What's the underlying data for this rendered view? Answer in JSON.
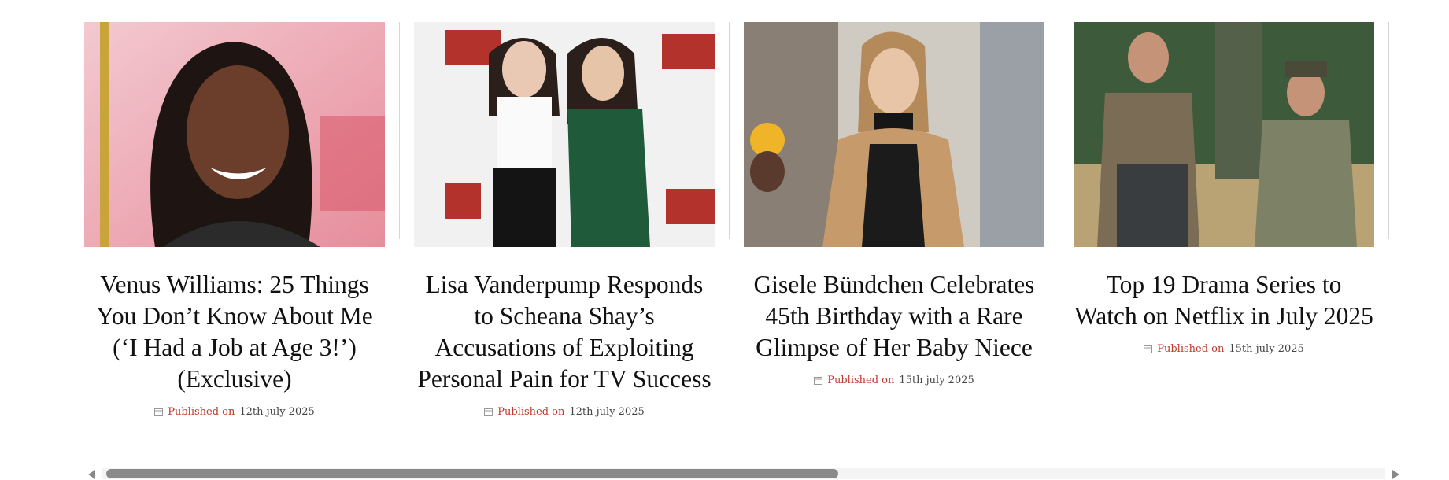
{
  "cards": [
    {
      "title": "Venus Williams: 25 Things You Don’t Know About Me (‘I Had a Job at Age 3!’) (Exclusive)",
      "published_label": "Published on",
      "date": "12th july 2025",
      "image_desc": "venus-williams-photo"
    },
    {
      "title": "Lisa Vanderpump Responds to Scheana Shay’s Accusations of Exploiting Personal Pain for TV Success",
      "published_label": "Published on",
      "date": "12th july 2025",
      "image_desc": "lisa-vanderpump-scheana-shay-photo"
    },
    {
      "title": "Gisele Bündchen Celebrates 45th Birthday with a Rare Glimpse of Her Baby Niece",
      "published_label": "Published on",
      "date": "15th july 2025",
      "image_desc": "gisele-bundchen-photo"
    },
    {
      "title": "Top 19 Drama Series to Watch on Netflix in July 2025",
      "published_label": "Published on",
      "date": "15th july 2025",
      "image_desc": "netflix-drama-still-photo"
    }
  ],
  "icons": {
    "calendar": "calendar-icon",
    "scroll_left": "arrow-left-icon",
    "scroll_right": "arrow-right-icon"
  },
  "colors": {
    "published_accent": "#c0392b",
    "text": "#111111"
  }
}
